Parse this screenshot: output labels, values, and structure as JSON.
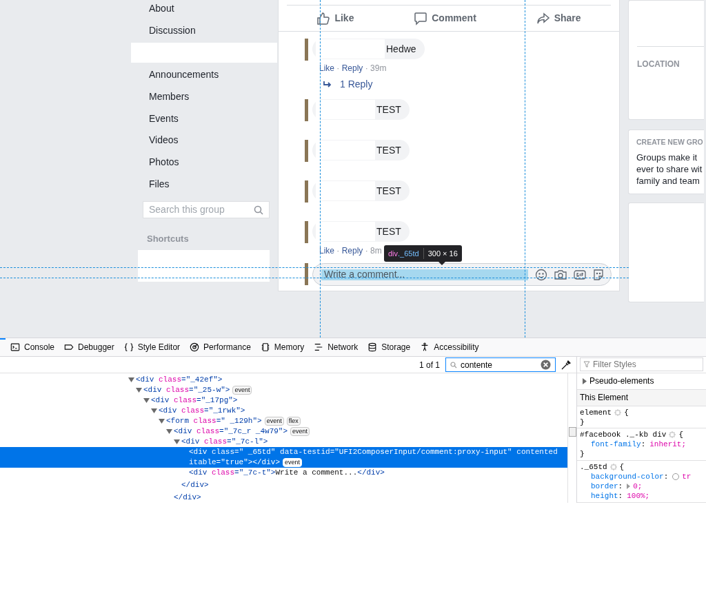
{
  "group_nav": {
    "items_top": [
      {
        "label": "About"
      },
      {
        "label": "Discussion"
      }
    ],
    "items": [
      {
        "label": "Announcements"
      },
      {
        "label": "Members"
      },
      {
        "label": "Events"
      },
      {
        "label": "Videos"
      },
      {
        "label": "Photos"
      },
      {
        "label": "Files"
      }
    ],
    "search": {
      "placeholder": "Search this group"
    },
    "shortcuts_heading": "Shortcuts"
  },
  "post": {
    "actions": [
      {
        "kind": "like",
        "label": "Like"
      },
      {
        "kind": "comment",
        "label": "Comment"
      },
      {
        "kind": "share",
        "label": "Share"
      }
    ],
    "comments": [
      {
        "text": "Hedwe",
        "meta": [
          {
            "kind": "link",
            "text": "Like"
          },
          {
            "kind": "plain",
            "text": " · "
          },
          {
            "kind": "link",
            "text": "Reply"
          },
          {
            "kind": "plain",
            "text": " · 39m"
          }
        ],
        "reply_link": "1 Reply"
      },
      {
        "text": "TEST"
      },
      {
        "text": "TEST"
      },
      {
        "text": "TEST"
      },
      {
        "text": "TEST",
        "meta": [
          {
            "kind": "link",
            "text": "Like"
          },
          {
            "kind": "plain",
            "text": " · "
          },
          {
            "kind": "link",
            "text": "Reply"
          },
          {
            "kind": "plain",
            "text": " · 8m"
          }
        ]
      }
    ],
    "composer": {
      "placeholder": "Write a comment..."
    }
  },
  "highlight_tooltip": {
    "tag": "div",
    "class": "._65td",
    "size": "300 × 16"
  },
  "right_column": {
    "location_heading": "LOCATION",
    "create_heading": "CREATE NEW GRO",
    "create_lines": [
      "Groups make it",
      "ever to share wit",
      "family and team"
    ]
  },
  "devtools": {
    "tabs": [
      {
        "kind": "console",
        "label": "Console",
        "selected": false
      },
      {
        "kind": "debugger",
        "label": "Debugger",
        "selected": false
      },
      {
        "kind": "style",
        "label": "Style Editor",
        "selected": false
      },
      {
        "kind": "performance",
        "label": "Performance",
        "selected": false
      },
      {
        "kind": "memory",
        "label": "Memory",
        "selected": false
      },
      {
        "kind": "network",
        "label": "Network",
        "selected": false
      },
      {
        "kind": "storage",
        "label": "Storage",
        "selected": false
      },
      {
        "kind": "accessibility",
        "label": "Accessibility",
        "selected": false
      }
    ],
    "search": {
      "count": "1 of 1",
      "value": "contente"
    },
    "markup": [
      {
        "expanded": true,
        "selected": false,
        "open": [
          {
            "kind": "tag",
            "t": "<div "
          },
          {
            "kind": "attr",
            "t": "class"
          },
          {
            "kind": "tag",
            "t": "=\"_42ef\">"
          }
        ],
        "children": [
          {
            "expanded": true,
            "selected": false,
            "badges": [
              "event"
            ],
            "open": [
              {
                "kind": "tag",
                "t": "<div "
              },
              {
                "kind": "attr",
                "t": "class"
              },
              {
                "kind": "tag",
                "t": "=\"_25-w\">"
              }
            ],
            "children": [
              {
                "expanded": true,
                "selected": false,
                "open": [
                  {
                    "kind": "tag",
                    "t": "<div "
                  },
                  {
                    "kind": "attr",
                    "t": "class"
                  },
                  {
                    "kind": "tag",
                    "t": "=\"_17pg\">"
                  }
                ],
                "children": [
                  {
                    "expanded": true,
                    "selected": false,
                    "open": [
                      {
                        "kind": "tag",
                        "t": "<div "
                      },
                      {
                        "kind": "attr",
                        "t": "class"
                      },
                      {
                        "kind": "tag",
                        "t": "=\"_1rwk\">"
                      }
                    ],
                    "children": [
                      {
                        "expanded": true,
                        "selected": false,
                        "badges": [
                          "event",
                          "flex"
                        ],
                        "open": [
                          {
                            "kind": "tag",
                            "t": "<form "
                          },
                          {
                            "kind": "attr",
                            "t": "class"
                          },
                          {
                            "kind": "tag",
                            "t": "=\" _129h\">"
                          }
                        ],
                        "children": [
                          {
                            "expanded": true,
                            "selected": false,
                            "badges": [
                              "event"
                            ],
                            "open": [
                              {
                                "kind": "tag",
                                "t": "<div "
                              },
                              {
                                "kind": "attr",
                                "t": "class"
                              },
                              {
                                "kind": "tag",
                                "t": "=\"_7c_r _4w79\">"
                              }
                            ],
                            "close": [
                              {
                                "kind": "tag",
                                "t": "</div>"
                              }
                            ],
                            "children": [
                              {
                                "expanded": true,
                                "selected": false,
                                "open": [
                                  {
                                    "kind": "tag",
                                    "t": "<div "
                                  },
                                  {
                                    "kind": "attr",
                                    "t": "class"
                                  },
                                  {
                                    "kind": "tag",
                                    "t": "=\"_7c-l\">"
                                  }
                                ],
                                "close": [
                                  {
                                    "kind": "tag",
                                    "t": "</div>"
                                  }
                                ],
                                "children": [
                                  {
                                    "selected": true,
                                    "badges": [
                                      "event"
                                    ],
                                    "open": [
                                      {
                                        "kind": "tag",
                                        "t": "<div "
                                      },
                                      {
                                        "kind": "attr",
                                        "t": "class"
                                      },
                                      {
                                        "kind": "tag",
                                        "t": "=\" _65td\" "
                                      },
                                      {
                                        "kind": "attr",
                                        "t": "data-testid"
                                      },
                                      {
                                        "kind": "tag",
                                        "t": "=\"UFI2ComposerInput/comment:proxy-input\" "
                                      },
                                      {
                                        "kind": "attr",
                                        "t": "contenteditable"
                                      },
                                      {
                                        "kind": "tag",
                                        "t": "=\"true\"></div>"
                                      }
                                    ]
                                  },
                                  {
                                    "selected": false,
                                    "open": [
                                      {
                                        "kind": "tag",
                                        "t": "<div "
                                      },
                                      {
                                        "kind": "attr",
                                        "t": "class"
                                      },
                                      {
                                        "kind": "tag",
                                        "t": "=\"_7c-t\">"
                                      },
                                      {
                                        "kind": "text",
                                        "t": "Write a comment..."
                                      },
                                      {
                                        "kind": "tag",
                                        "t": "</div>"
                                      }
                                    ]
                                  }
                                ]
                              }
                            ]
                          }
                        ]
                      }
                    ]
                  }
                ]
              }
            ]
          }
        ]
      }
    ],
    "rules": {
      "filter_placeholder": "Filter Styles",
      "pseudo_label": "Pseudo-elements",
      "section_label": "This Element",
      "items": [
        {
          "selector": "element",
          "open": "{",
          "close": "}"
        },
        {
          "selector": "#facebook ._-kb div",
          "open": "{",
          "close": "}",
          "decls": [
            {
              "kind": "plain",
              "name": "font-family",
              "colon": ":",
              "value": "inherit;"
            }
          ]
        },
        {
          "selector": "._65td",
          "open": "{",
          "decls": [
            {
              "kind": "color",
              "name": "background-color",
              "colon": ":",
              "value": "tr"
            },
            {
              "kind": "shorthand",
              "name": "border",
              "colon": ":",
              "value": "0;"
            },
            {
              "kind": "plain",
              "name": "height",
              "colon": ":",
              "value": "100%;"
            }
          ]
        }
      ]
    }
  }
}
